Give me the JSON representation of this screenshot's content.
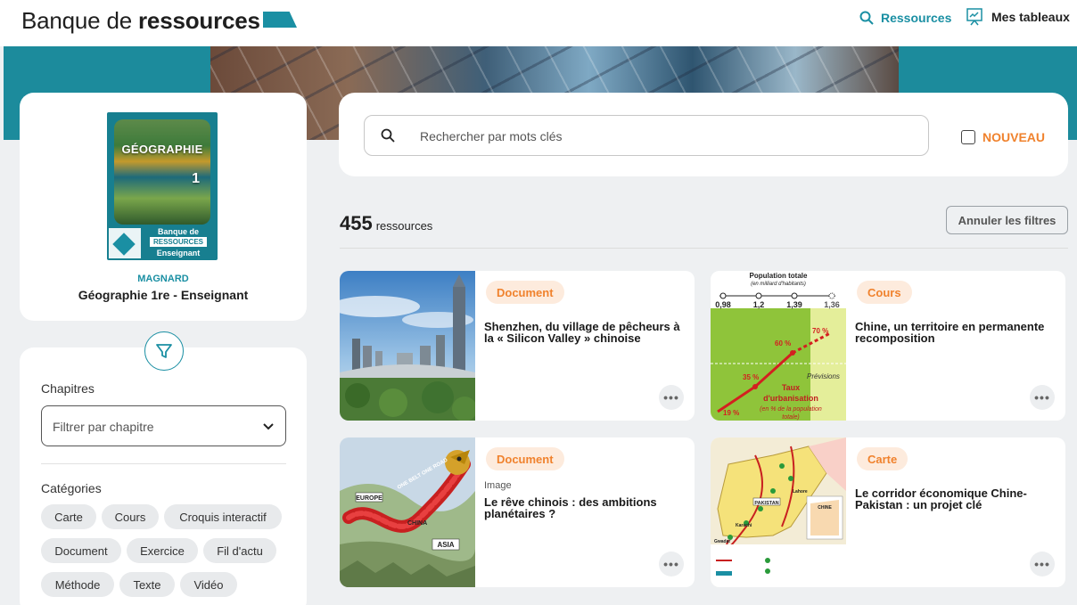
{
  "header": {
    "brand_prefix": "Banque de ",
    "brand_bold": "ressources",
    "nav": [
      {
        "label": "Ressources",
        "icon": "search-icon"
      },
      {
        "label": "Mes tableaux",
        "icon": "board-icon"
      }
    ]
  },
  "book": {
    "cover_title": "GÉOGRAPHIE",
    "cover_number": "1",
    "cover_line1": "Banque de",
    "cover_line2": "RESSOURCES",
    "cover_line3": "Enseignant",
    "publisher": "MAGNARD",
    "title": "Géographie 1re - Enseignant"
  },
  "filters": {
    "chapters_label": "Chapitres",
    "chapter_select_placeholder": "Filtrer par chapitre",
    "categories_label": "Catégories",
    "categories": [
      "Carte",
      "Cours",
      "Croquis interactif",
      "Document",
      "Exercice",
      "Fil d'actu",
      "Méthode",
      "Texte",
      "Vidéo"
    ]
  },
  "search": {
    "placeholder": "Rechercher par mots clés",
    "new_label": "NOUVEAU"
  },
  "results": {
    "count": "455",
    "count_label": "ressources",
    "reset_label": "Annuler les filtres"
  },
  "cards": [
    {
      "badge": "Document",
      "subtitle": "",
      "title": "Shenzhen, du village de pêcheurs à la « Silicon Valley » chinoise"
    },
    {
      "badge": "Cours",
      "subtitle": "",
      "title": "Chine, un territoire en permanente recomposition"
    },
    {
      "badge": "Document",
      "subtitle": "Image",
      "title": "Le rêve chinois : des ambitions planétaires ?"
    },
    {
      "badge": "Carte",
      "subtitle": "",
      "title": "Le corridor économique Chine-Pakistan : un projet clé"
    }
  ],
  "thumb_chart": {
    "title": "Population totale",
    "subtitle": "(en milliard d'habitants)",
    "values": [
      "0,98",
      "1,2",
      "1,39",
      "1,36"
    ],
    "pcts": [
      "19 %",
      "35 %",
      "60 %",
      "70 %"
    ],
    "previsions": "Prévisions",
    "label1": "Taux",
    "label2": "d'urbanisation",
    "label3": "(en % de la population",
    "label4": "totale)"
  },
  "thumb_cartoon": {
    "europe": "EUROPE",
    "asia": "ASIA",
    "road": "ONE BELT ONE ROAD",
    "china": "CHINA"
  },
  "thumb_map": {
    "pakistan": "PAKISTAN",
    "chine": "CHINE",
    "karachi": "Karachi",
    "gwadar": "Gwadar",
    "lahore": "Lahore"
  },
  "colors": {
    "accent": "#1a8fa3",
    "orange": "#f0822d",
    "badge_bg": "#fdebdd"
  }
}
